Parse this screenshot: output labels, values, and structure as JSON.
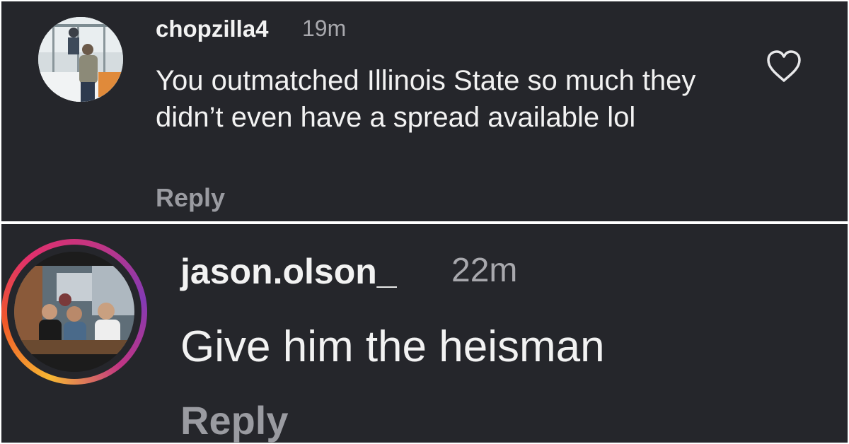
{
  "comments": [
    {
      "username": "chopzilla4",
      "time": "19m",
      "text": "You outmatched Illinois State so much they didn’t even have a spread available lol",
      "reply_label": "Reply",
      "like_icon": "heart-icon",
      "avatar": "profile-photo"
    },
    {
      "username": "jason.olson_",
      "time": "22m",
      "text": "Give him the heisman",
      "reply_label": "Reply",
      "avatar": "profile-photo-with-story-ring"
    }
  ],
  "colors": {
    "background": "#25262b",
    "text": "#f2f2f2",
    "muted": "#a8a8ad",
    "reply": "#9a9ba1",
    "story_ring": [
      "#f7b733",
      "#f05a28",
      "#e1306c",
      "#c13584",
      "#833ab4"
    ]
  }
}
